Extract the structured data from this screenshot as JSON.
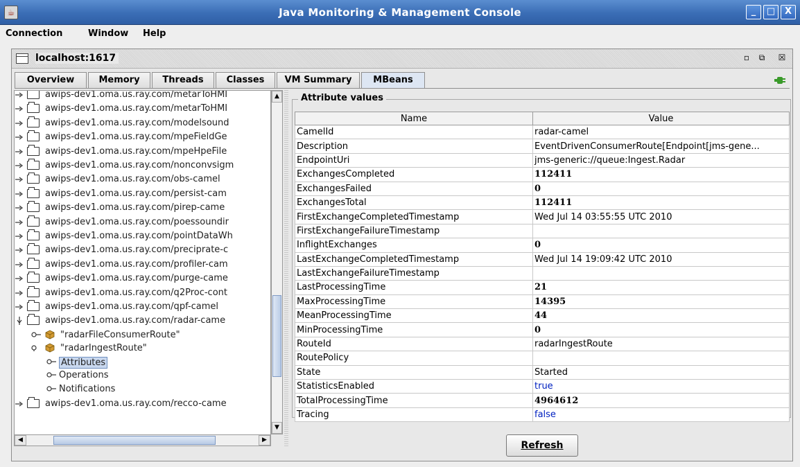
{
  "window": {
    "title": "Java Monitoring & Management Console",
    "minimize": "_",
    "maximize": "□",
    "close": "X"
  },
  "menubar": {
    "items": [
      "Connection",
      "Window",
      "Help"
    ]
  },
  "frame": {
    "title": "localhost:1617",
    "btn_iconify": "▫",
    "btn_restore": "⧉",
    "btn_close": "☒"
  },
  "tabs": [
    "Overview",
    "Memory",
    "Threads",
    "Classes",
    "VM Summary",
    "MBeans"
  ],
  "active_tab": "MBeans",
  "tree": {
    "domains": [
      "awips-dev1.oma.us.ray.com/metarToHMI",
      "awips-dev1.oma.us.ray.com/metarToHMI",
      "awips-dev1.oma.us.ray.com/modelsound",
      "awips-dev1.oma.us.ray.com/mpeFieldGe",
      "awips-dev1.oma.us.ray.com/mpeHpeFile",
      "awips-dev1.oma.us.ray.com/nonconvsigm",
      "awips-dev1.oma.us.ray.com/obs-camel",
      "awips-dev1.oma.us.ray.com/persist-cam",
      "awips-dev1.oma.us.ray.com/pirep-came",
      "awips-dev1.oma.us.ray.com/poessoundir",
      "awips-dev1.oma.us.ray.com/pointDataWh",
      "awips-dev1.oma.us.ray.com/preciprate-c",
      "awips-dev1.oma.us.ray.com/profiler-cam",
      "awips-dev1.oma.us.ray.com/purge-came",
      "awips-dev1.oma.us.ray.com/q2Proc-cont",
      "awips-dev1.oma.us.ray.com/qpf-camel",
      "awips-dev1.oma.us.ray.com/radar-came"
    ],
    "routes": [
      "\"radarFileConsumerRoute\"",
      "\"radarIngestRoute\""
    ],
    "children": [
      "Attributes",
      "Operations",
      "Notifications"
    ],
    "last_domain": "awips-dev1.oma.us.ray.com/recco-came"
  },
  "attributes": {
    "group_title": "Attribute values",
    "col_name": "Name",
    "col_value": "Value",
    "rows": [
      {
        "name": "CamelId",
        "value": "radar-camel",
        "style": ""
      },
      {
        "name": "Description",
        "value": "EventDrivenConsumerRoute[Endpoint[jms-gene...",
        "style": ""
      },
      {
        "name": "EndpointUri",
        "value": "jms-generic://queue:Ingest.Radar",
        "style": ""
      },
      {
        "name": "ExchangesCompleted",
        "value": "112411",
        "style": "b"
      },
      {
        "name": "ExchangesFailed",
        "value": "0",
        "style": "b"
      },
      {
        "name": "ExchangesTotal",
        "value": "112411",
        "style": "b"
      },
      {
        "name": "FirstExchangeCompletedTimestamp",
        "value": "Wed Jul 14 03:55:55 UTC 2010",
        "style": ""
      },
      {
        "name": "FirstExchangeFailureTimestamp",
        "value": "",
        "style": ""
      },
      {
        "name": "InflightExchanges",
        "value": "0",
        "style": "b"
      },
      {
        "name": "LastExchangeCompletedTimestamp",
        "value": "Wed Jul 14 19:09:42 UTC 2010",
        "style": ""
      },
      {
        "name": "LastExchangeFailureTimestamp",
        "value": "",
        "style": ""
      },
      {
        "name": "LastProcessingTime",
        "value": "21",
        "style": "b"
      },
      {
        "name": "MaxProcessingTime",
        "value": "14395",
        "style": "b"
      },
      {
        "name": "MeanProcessingTime",
        "value": "44",
        "style": "b"
      },
      {
        "name": "MinProcessingTime",
        "value": "0",
        "style": "b"
      },
      {
        "name": "RouteId",
        "value": "radarIngestRoute",
        "style": ""
      },
      {
        "name": "RoutePolicy",
        "value": "",
        "style": ""
      },
      {
        "name": "State",
        "value": "Started",
        "style": ""
      },
      {
        "name": "StatisticsEnabled",
        "value": "true",
        "style": "blue"
      },
      {
        "name": "TotalProcessingTime",
        "value": "4964612",
        "style": "b"
      },
      {
        "name": "Tracing",
        "value": "false",
        "style": "blue"
      }
    ],
    "refresh_label": "Refresh"
  },
  "colors": {
    "titlebar": "#3a6db5",
    "selection": "#c9d8ef",
    "boolean_text": "#0020c0",
    "bean_icon": "#d39a32",
    "plug_icon": "#3a9a2a"
  }
}
